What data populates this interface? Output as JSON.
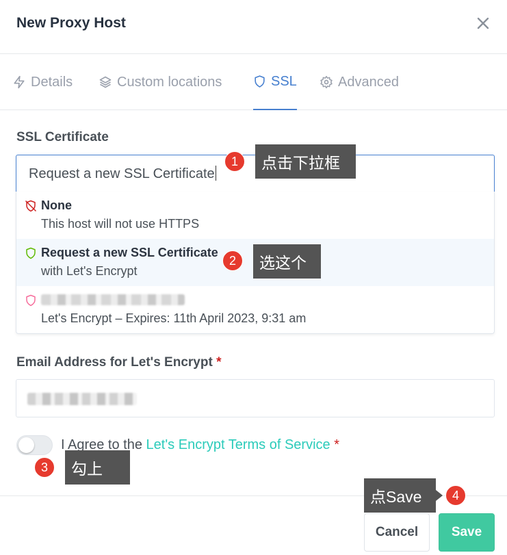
{
  "dialog": {
    "title": "New Proxy Host"
  },
  "tabs": [
    {
      "label": "Details",
      "icon": "lightning-icon",
      "active": false
    },
    {
      "label": "Custom locations",
      "icon": "layers-icon",
      "active": false
    },
    {
      "label": "SSL",
      "icon": "shield-icon",
      "active": true
    },
    {
      "label": "Advanced",
      "icon": "gear-icon",
      "active": false
    }
  ],
  "ssl": {
    "label": "SSL Certificate",
    "selected_value": "Request a new SSL Certificate",
    "options": [
      {
        "title": "None",
        "subtitle": "This host will not use HTTPS",
        "icon": "shield-off-icon",
        "icon_color": "#cd201f"
      },
      {
        "title": "Request a new SSL Certificate",
        "subtitle": "with Let's Encrypt",
        "icon": "shield-icon",
        "icon_color": "#5eba00",
        "highlighted": true
      },
      {
        "title": "",
        "subtitle": "Let's Encrypt – Expires: 11th April 2023, 9:31 am",
        "icon": "shield-icon",
        "icon_color": "#f66d9b",
        "redacted": true
      }
    ]
  },
  "email": {
    "label": "Email Address for Let's Encrypt",
    "required_mark": "*",
    "value_redacted": true
  },
  "agree": {
    "prefix": "I Agree to the",
    "link": "Let's Encrypt Terms of Service",
    "required_mark": "*",
    "checked": false
  },
  "footer": {
    "cancel_label": "Cancel",
    "save_label": "Save"
  },
  "annotations": [
    {
      "number": "1",
      "text": "点击下拉框"
    },
    {
      "number": "2",
      "text": "选这个"
    },
    {
      "number": "3",
      "text": "勾上"
    },
    {
      "number": "4",
      "text": "点Save"
    }
  ],
  "colors": {
    "accent": "#467fcf",
    "link": "#2bcbba",
    "save_button": "#40c9a0",
    "required": "#cd201f",
    "annotation_badge": "#e63a2e",
    "annotation_box": "#545454"
  }
}
